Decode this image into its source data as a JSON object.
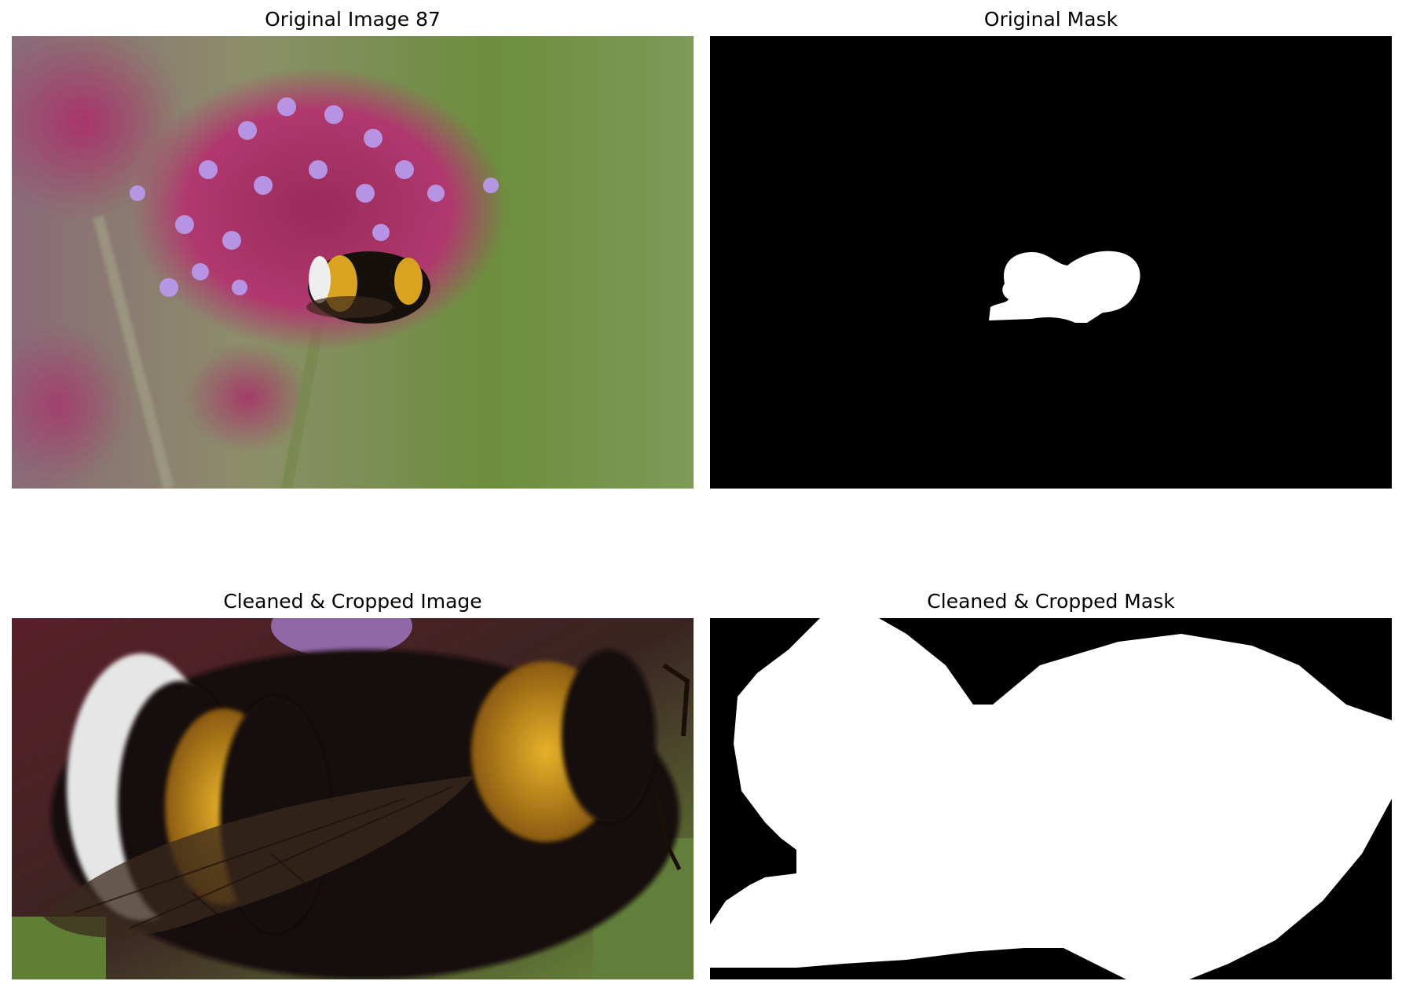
{
  "panels": [
    {
      "title": "Original Image 87",
      "kind": "photo"
    },
    {
      "title": "Original Mask",
      "kind": "mask"
    },
    {
      "title": "Cleaned & Cropped Image",
      "kind": "photo-crop"
    },
    {
      "title": "Cleaned & Cropped Mask",
      "kind": "mask-crop"
    }
  ],
  "colors": {
    "background": "#ffffff",
    "mask_fg": "#ffffff",
    "mask_bg": "#000000",
    "bee_yellow": "#d9a21f",
    "bee_black": "#16100c",
    "flower_pink": "#b0386e",
    "flower_lilac": "#b899ea",
    "backdrop_green": "#6c8e3e"
  },
  "icons": [
    "bumblebee-photo",
    "verbena-flower-photo",
    "segmentation-mask"
  ]
}
